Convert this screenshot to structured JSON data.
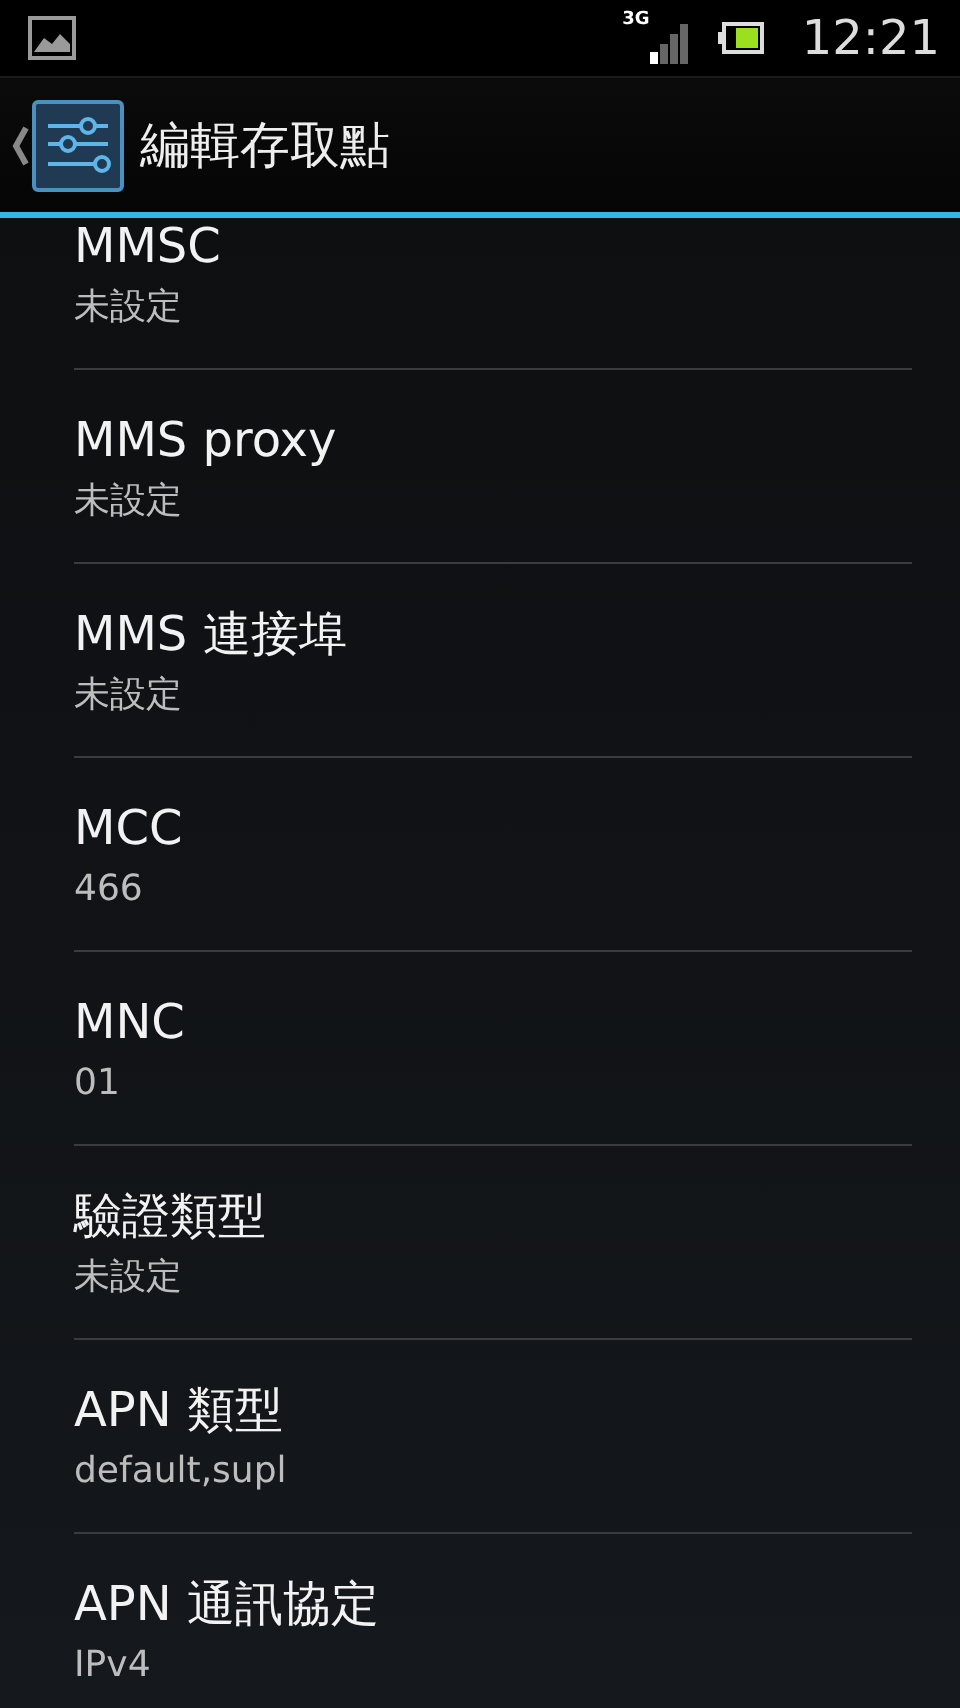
{
  "status_bar": {
    "network": "3G",
    "time": "12:21"
  },
  "action_bar": {
    "title": "編輯存取點"
  },
  "settings": [
    {
      "title": "MMSC",
      "summary": "未設定"
    },
    {
      "title": "MMS proxy",
      "summary": "未設定"
    },
    {
      "title": "MMS 連接埠",
      "summary": "未設定"
    },
    {
      "title": "MCC",
      "summary": "466"
    },
    {
      "title": "MNC",
      "summary": "01"
    },
    {
      "title": "驗證類型",
      "summary": "未設定"
    },
    {
      "title": "APN 類型",
      "summary": "default,supl"
    },
    {
      "title": "APN 通訊協定",
      "summary": "IPv4"
    }
  ]
}
